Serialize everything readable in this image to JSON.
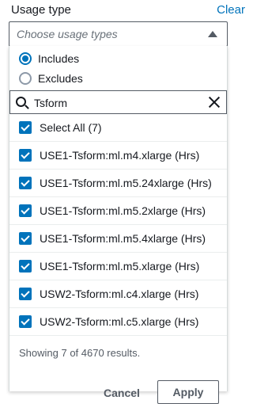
{
  "header": {
    "label": "Usage type",
    "clear_label": "Clear"
  },
  "select": {
    "placeholder": "Choose usage types",
    "caret_icon": "caret-up-icon"
  },
  "filter_mode": {
    "options": [
      {
        "label": "Includes",
        "selected": true
      },
      {
        "label": "Excludes",
        "selected": false
      }
    ]
  },
  "search": {
    "value": "Tsform",
    "icon": "search-icon",
    "clear_icon": "close-icon"
  },
  "options": [
    {
      "label": "Select All (7)",
      "checked": true
    },
    {
      "label": "USE1-Tsform:ml.m4.xlarge (Hrs)",
      "checked": true
    },
    {
      "label": "USE1-Tsform:ml.m5.24xlarge (Hrs)",
      "checked": true
    },
    {
      "label": "USE1-Tsform:ml.m5.2xlarge (Hrs)",
      "checked": true
    },
    {
      "label": "USE1-Tsform:ml.m5.4xlarge (Hrs)",
      "checked": true
    },
    {
      "label": "USE1-Tsform:ml.m5.xlarge (Hrs)",
      "checked": true
    },
    {
      "label": "USW2-Tsform:ml.c4.xlarge (Hrs)",
      "checked": true
    },
    {
      "label": "USW2-Tsform:ml.c5.xlarge (Hrs)",
      "checked": true
    }
  ],
  "footer": {
    "results_text": "Showing 7 of 4670 results.",
    "cancel_label": "Cancel",
    "apply_label": "Apply"
  },
  "colors": {
    "accent": "#0073bb",
    "text": "#16191f",
    "muted": "#545b64"
  }
}
